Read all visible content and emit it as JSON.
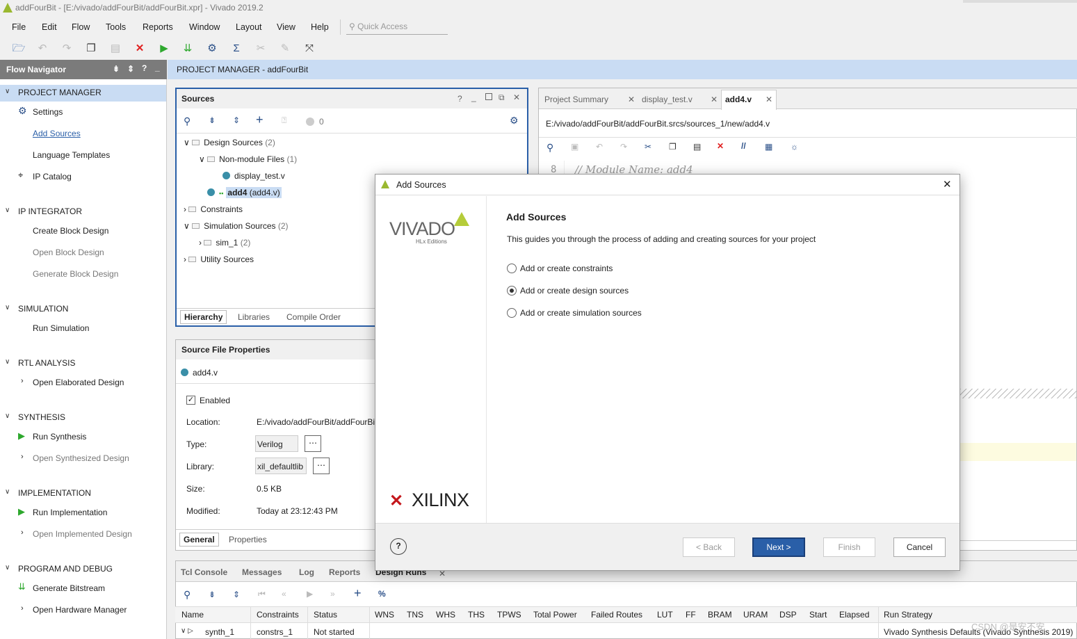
{
  "window": {
    "title": "addFourBit - [E:/vivado/addFourBit/addFourBit.xpr] - Vivado 2019.2"
  },
  "menu": [
    "File",
    "Edit",
    "Flow",
    "Tools",
    "Reports",
    "Window",
    "Layout",
    "View",
    "Help"
  ],
  "quick_access": {
    "placeholder": "Quick Access"
  },
  "flow_navigator": {
    "title": "Flow Navigator",
    "sections": {
      "project_manager": "PROJECT MANAGER",
      "settings": "Settings",
      "add_sources": "Add Sources",
      "language_templates": "Language Templates",
      "ip_catalog": "IP Catalog",
      "ip_integrator": "IP INTEGRATOR",
      "create_block_design": "Create Block Design",
      "open_block_design": "Open Block Design",
      "generate_block_design": "Generate Block Design",
      "simulation": "SIMULATION",
      "run_simulation": "Run Simulation",
      "rtl_analysis": "RTL ANALYSIS",
      "open_elaborated_design": "Open Elaborated Design",
      "synthesis": "SYNTHESIS",
      "run_synthesis": "Run Synthesis",
      "open_synthesized_design": "Open Synthesized Design",
      "implementation": "IMPLEMENTATION",
      "run_implementation": "Run Implementation",
      "open_implemented_design": "Open Implemented Design",
      "program_and_debug": "PROGRAM AND DEBUG",
      "generate_bitstream": "Generate Bitstream",
      "open_hardware_manager": "Open Hardware Manager"
    }
  },
  "project_manager_header": {
    "title": "PROJECT MANAGER",
    "project": " - addFourBit"
  },
  "sources": {
    "title": "Sources",
    "count_badge": "0",
    "tree": {
      "design_sources": "Design Sources",
      "design_sources_count": "(2)",
      "non_module_files": "Non-module Files",
      "non_module_count": "(1)",
      "display_test": "display_test.v",
      "add4": "add4",
      "add4_file": "(add4.v)",
      "constraints": "Constraints",
      "simulation_sources": "Simulation Sources",
      "simulation_count": "(2)",
      "sim_1": "sim_1",
      "sim_1_count": "(2)",
      "utility_sources": "Utility Sources"
    },
    "tabs": [
      "Hierarchy",
      "Libraries",
      "Compile Order"
    ]
  },
  "source_file_properties": {
    "title": "Source File Properties",
    "file": "add4.v",
    "enabled_label": "Enabled",
    "location_label": "Location:",
    "location_value": "E:/vivado/addFourBit/addFourBi",
    "type_label": "Type:",
    "type_value": "Verilog",
    "library_label": "Library:",
    "library_value": "xil_defaultlib",
    "size_label": "Size:",
    "size_value": "0.5 KB",
    "modified_label": "Modified:",
    "modified_value": "Today at 23:12:43 PM",
    "tabs": [
      "General",
      "Properties"
    ]
  },
  "editor": {
    "tabs": [
      "Project Summary",
      "display_test.v",
      "add4.v"
    ],
    "path": "E:/vivado/addFourBit/addFourBit.srcs/sources_1/new/add4.v",
    "line_number": "8",
    "code_line": "// Module Name: add4"
  },
  "dialog": {
    "title": "Add Sources",
    "heading": "Add Sources",
    "description": "This guides you through the process of adding and creating sources for your project",
    "options": [
      "Add or create constraints",
      "Add or create design sources",
      "Add or create simulation sources"
    ],
    "selected_index": 1,
    "vivado_logo": "VIVADO",
    "vivado_sub": "HLx Editions",
    "xilinx_logo": "XILINX",
    "buttons": {
      "back": "< Back",
      "next": "Next >",
      "finish": "Finish",
      "cancel": "Cancel"
    }
  },
  "bottom": {
    "tabs": [
      "Tcl Console",
      "Messages",
      "Log",
      "Reports",
      "Design Runs"
    ],
    "columns": [
      "Name",
      "Constraints",
      "Status",
      "WNS",
      "TNS",
      "WHS",
      "THS",
      "TPWS",
      "Total Power",
      "Failed Routes",
      "LUT",
      "FF",
      "BRAM",
      "URAM",
      "DSP",
      "Start",
      "Elapsed",
      "Run Strategy"
    ],
    "row": {
      "name": "synth_1",
      "constraints": "constrs_1",
      "status": "Not started",
      "strategy": "Vivado Synthesis Defaults (Vivado Synthesis 2019)"
    }
  },
  "watermark": "CSDN @是安不安",
  "colors": {
    "accent": "#2a5fa8",
    "header_blue": "#c9dcf3",
    "nav_gray": "#7b7b7b",
    "run_green": "#2ea82e",
    "stop_red": "#e02020"
  }
}
